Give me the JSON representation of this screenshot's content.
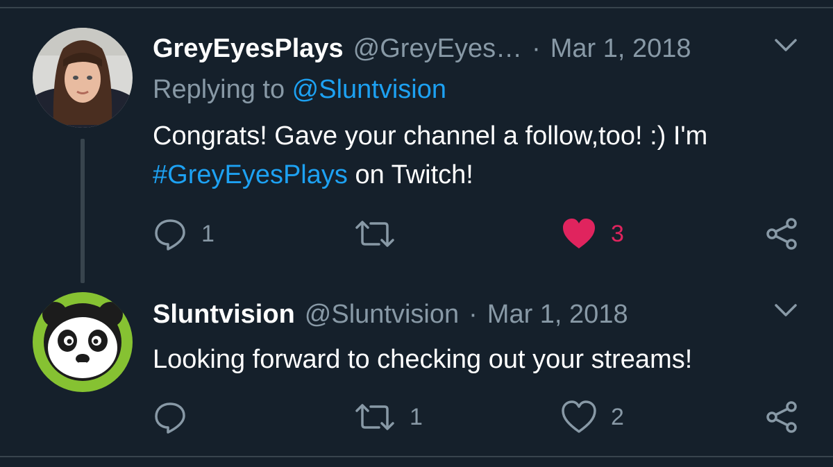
{
  "tweets": [
    {
      "author_name": "GreyEyesPlays",
      "handle": "@GreyEyes…",
      "separator": "·",
      "date": "Mar 1, 2018",
      "replying_prefix": "Replying to ",
      "replying_to": "@Sluntvision",
      "text_part1": "Congrats! Gave your channel a follow,too! :) I'm",
      "hashtag": "#GreyEyesPlays",
      "text_part2": " on Twitch!",
      "reply_count": "1",
      "retweet_count": "",
      "like_count": "3",
      "liked": true,
      "avatar_icon": "user-photo-avatar"
    },
    {
      "author_name": "Sluntvision",
      "handle": "@Sluntvision",
      "separator": "·",
      "date": "Mar 1, 2018",
      "text": "Looking forward to checking out your streams!",
      "reply_count": "",
      "retweet_count": "1",
      "like_count": "2",
      "liked": false,
      "avatar_icon": "panda-avatar"
    }
  ],
  "colors": {
    "background": "#15202b",
    "secondary_text": "#8899a6",
    "link": "#1da1f2",
    "like": "#e0245e",
    "divider": "#38444d"
  }
}
